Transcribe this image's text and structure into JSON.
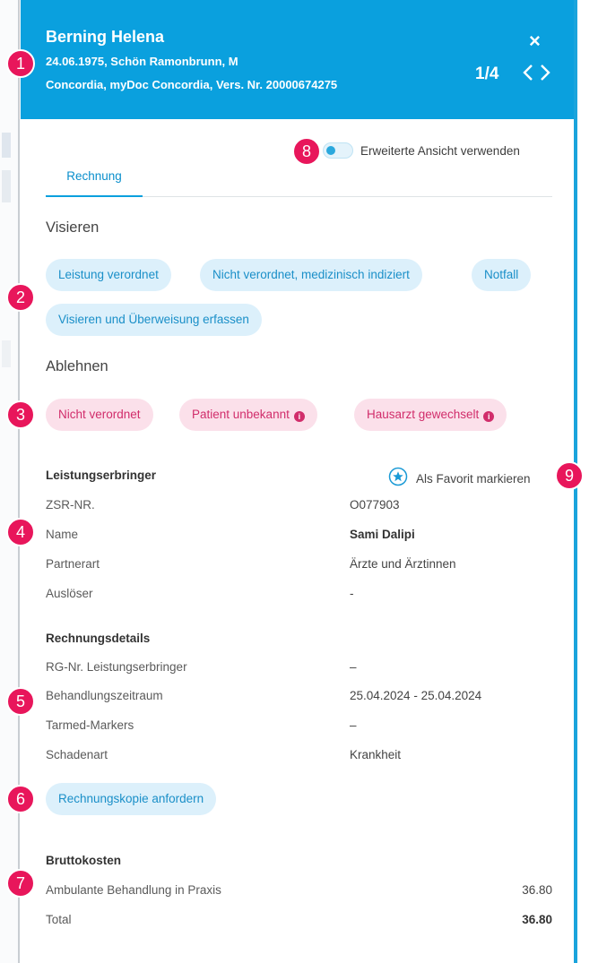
{
  "header": {
    "name": "Berning Helena",
    "line1": "24.06.1975, Schön Ramonbrunn, M",
    "line2": "Concordia, myDoc Concordia, Vers. Nr. 20000674275",
    "pager": "1/4",
    "close_icon": "close-icon",
    "prev_icon": "chevron-left-icon",
    "next_icon": "chevron-right-icon"
  },
  "toggle": {
    "label": "Erweiterte Ansicht verwenden",
    "on": false
  },
  "tabs": [
    {
      "label": "Rechnung",
      "active": true
    }
  ],
  "visieren": {
    "title": "Visieren",
    "buttons": [
      "Leistung verordnet",
      "Nicht verordnet, medizinisch indiziert",
      "Notfall",
      "Visieren und Überweisung erfassen"
    ]
  },
  "ablehnen": {
    "title": "Ablehnen",
    "buttons": [
      "Nicht verordnet",
      "Patient unbekannt",
      "Hausarzt gewechselt"
    ]
  },
  "leistungserbringer": {
    "title": "Leistungserbringer",
    "favorite_label": "Als Favorit markieren",
    "favorite_icon": "star-icon",
    "rows": [
      {
        "label": "ZSR-NR.",
        "value": "O077903"
      },
      {
        "label": "Name",
        "value": "Sami Dalipi"
      },
      {
        "label": "Partnerart",
        "value": "Ärzte und Ärztinnen"
      },
      {
        "label": "Auslöser",
        "value": "-"
      }
    ]
  },
  "rechnungsdetails": {
    "title": "Rechnungsdetails",
    "rows": [
      {
        "label": "RG-Nr. Leistungserbringer",
        "value": "–"
      },
      {
        "label": "Behandlungszeitraum",
        "value": "25.04.2024 - 25.04.2024"
      },
      {
        "label": "Tarmed-Markers",
        "value": "–"
      },
      {
        "label": "Schadenart",
        "value": "Krankheit"
      }
    ],
    "copy_button": "Rechnungskopie anfordern"
  },
  "bruttokosten": {
    "title": "Bruttokosten",
    "rows": [
      {
        "label": "Ambulante Behandlung in Praxis",
        "value": "36.80"
      },
      {
        "label": "Total",
        "value": "36.80"
      }
    ]
  },
  "callouts": [
    "1",
    "2",
    "3",
    "4",
    "5",
    "6",
    "7",
    "8",
    "9"
  ],
  "colors": {
    "header": "#0aa0de",
    "accent": "#1a8fc8",
    "reject": "#d12d6b",
    "callout": "#e8165b"
  }
}
